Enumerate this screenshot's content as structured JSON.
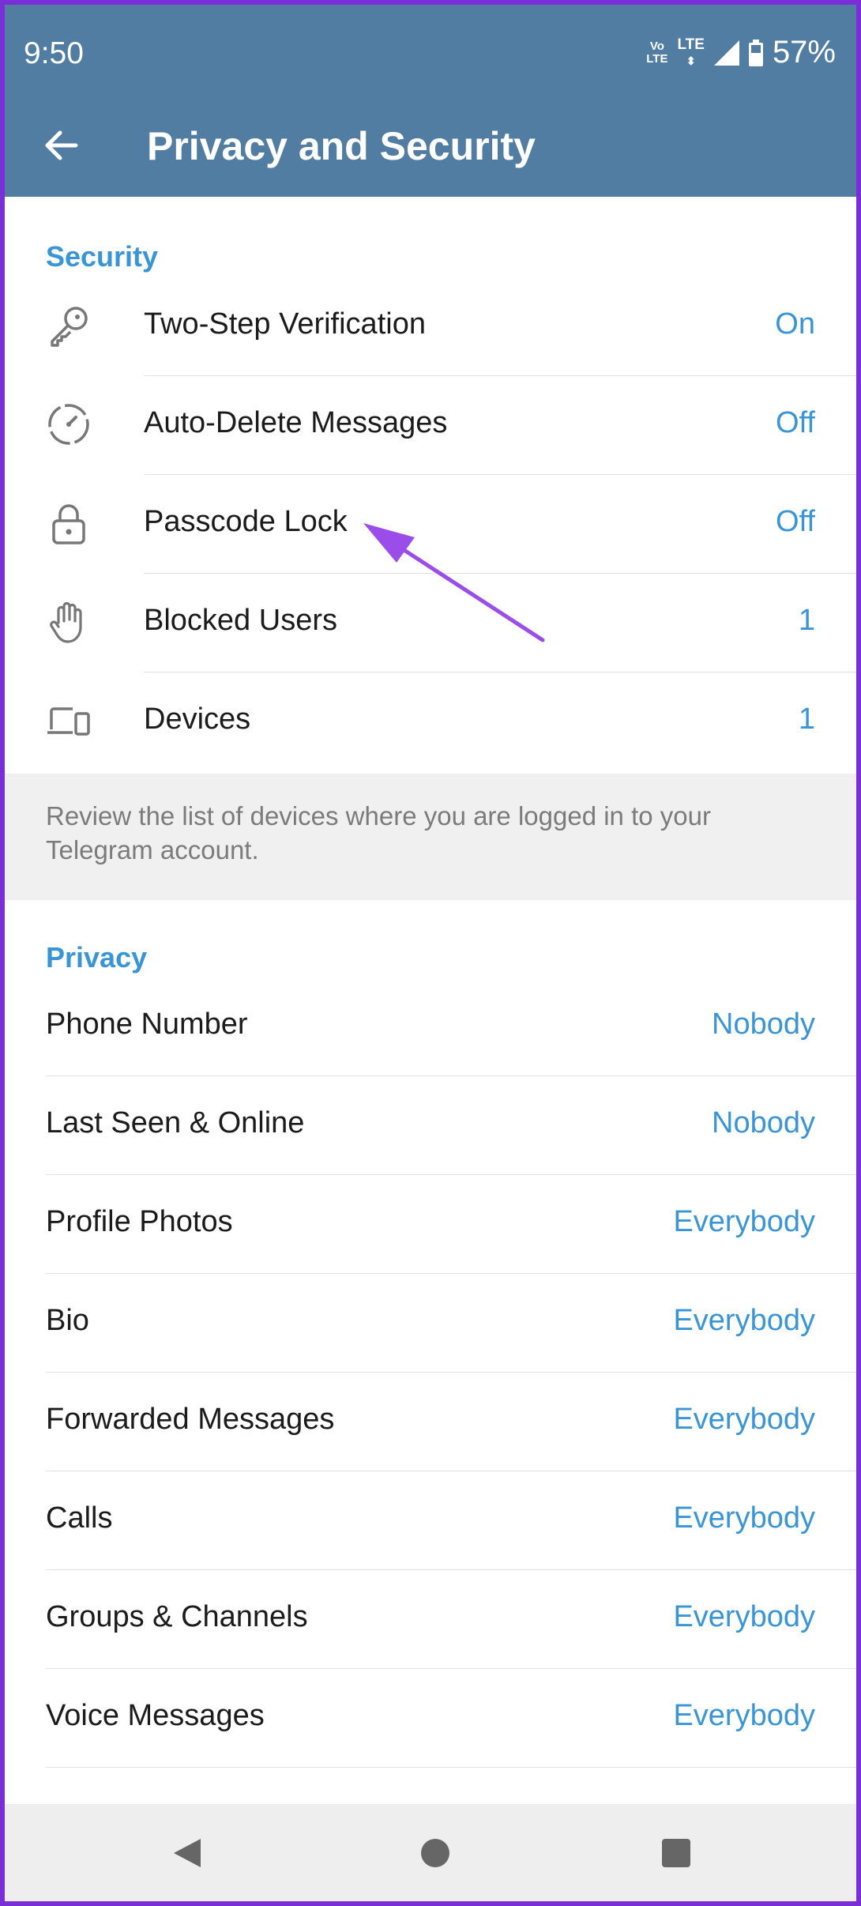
{
  "status": {
    "time": "9:50",
    "volte": "Vo\nLTE",
    "lte": "LTE",
    "battery": "57%"
  },
  "header": {
    "title": "Privacy and Security"
  },
  "security": {
    "header": "Security",
    "items": [
      {
        "label": "Two-Step Verification",
        "value": "On",
        "icon": "key-icon"
      },
      {
        "label": "Auto-Delete Messages",
        "value": "Off",
        "icon": "timer-icon"
      },
      {
        "label": "Passcode Lock",
        "value": "Off",
        "icon": "lock-icon"
      },
      {
        "label": "Blocked Users",
        "value": "1",
        "icon": "hand-icon"
      },
      {
        "label": "Devices",
        "value": "1",
        "icon": "devices-icon"
      }
    ],
    "info": "Review the list of devices where you are logged in to your Telegram account."
  },
  "privacy": {
    "header": "Privacy",
    "items": [
      {
        "label": "Phone Number",
        "value": "Nobody"
      },
      {
        "label": "Last Seen & Online",
        "value": "Nobody"
      },
      {
        "label": "Profile Photos",
        "value": "Everybody"
      },
      {
        "label": "Bio",
        "value": "Everybody"
      },
      {
        "label": "Forwarded Messages",
        "value": "Everybody"
      },
      {
        "label": "Calls",
        "value": "Everybody"
      },
      {
        "label": "Groups & Channels",
        "value": "Everybody"
      },
      {
        "label": "Voice Messages",
        "value": "Everybody"
      }
    ]
  },
  "colors": {
    "appbar": "#517da2",
    "accent": "#3a95d6",
    "annotation": "#9b4dea",
    "border": "#7a2fd6"
  }
}
